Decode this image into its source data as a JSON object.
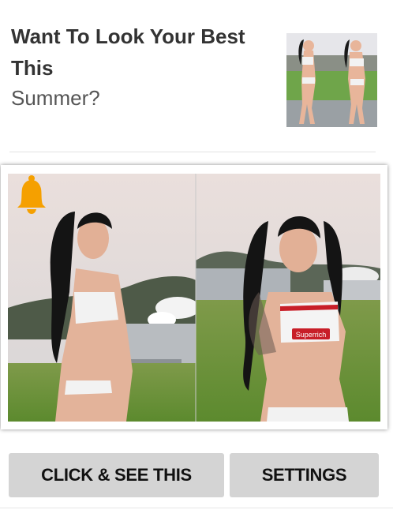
{
  "ad": {
    "headline_bold": "Want To Look Your Best This",
    "headline_light": "Summer?"
  },
  "buttons": {
    "cta_label": "CLICK & SEE THIS",
    "settings_label": "SETTINGS"
  },
  "photo": {
    "shirt_text": "Superrich"
  },
  "icons": {
    "notification": "bell-icon"
  },
  "colors": {
    "bell": "#f5a000",
    "button_bg": "#d4d4d4"
  }
}
